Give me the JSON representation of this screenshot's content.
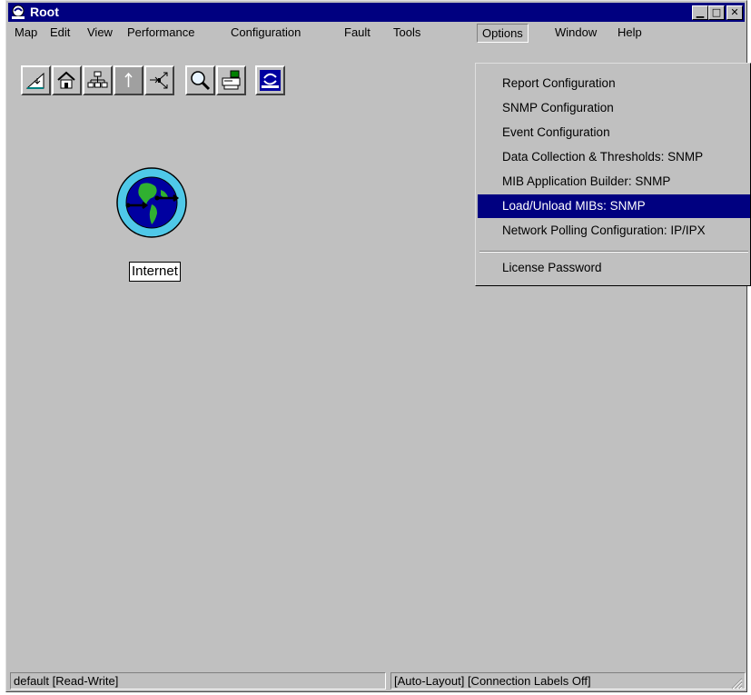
{
  "window": {
    "title": "Root"
  },
  "menubar": {
    "items": [
      "Map",
      "Edit",
      "View",
      "Performance",
      "Configuration",
      "Fault",
      "Tools",
      "Options",
      "Window",
      "Help"
    ]
  },
  "toolbar": {
    "buttons": [
      "new-map-icon",
      "home-icon",
      "hierarchy-icon",
      "up-arrow-icon",
      "navigate-icon",
      "search-icon",
      "printer-icon",
      "hp-openview-icon"
    ]
  },
  "canvas": {
    "node_label": "Internet"
  },
  "options_menu": {
    "items": [
      "Report Configuration",
      "SNMP Configuration",
      "Event Configuration",
      "Data Collection & Thresholds: SNMP",
      "MIB Application Builder: SNMP",
      "Load/Unload MIBs: SNMP",
      "Network Polling Configuration: IP/IPX",
      "License Password"
    ],
    "highlighted": "Load/Unload MIBs: SNMP"
  },
  "statusbar": {
    "left": "default [Read-Write]",
    "right": "[Auto-Layout] [Connection Labels Off]"
  },
  "colors": {
    "titlebar": "#000080",
    "face": "#c0c0c0",
    "highlight": "#000080"
  }
}
